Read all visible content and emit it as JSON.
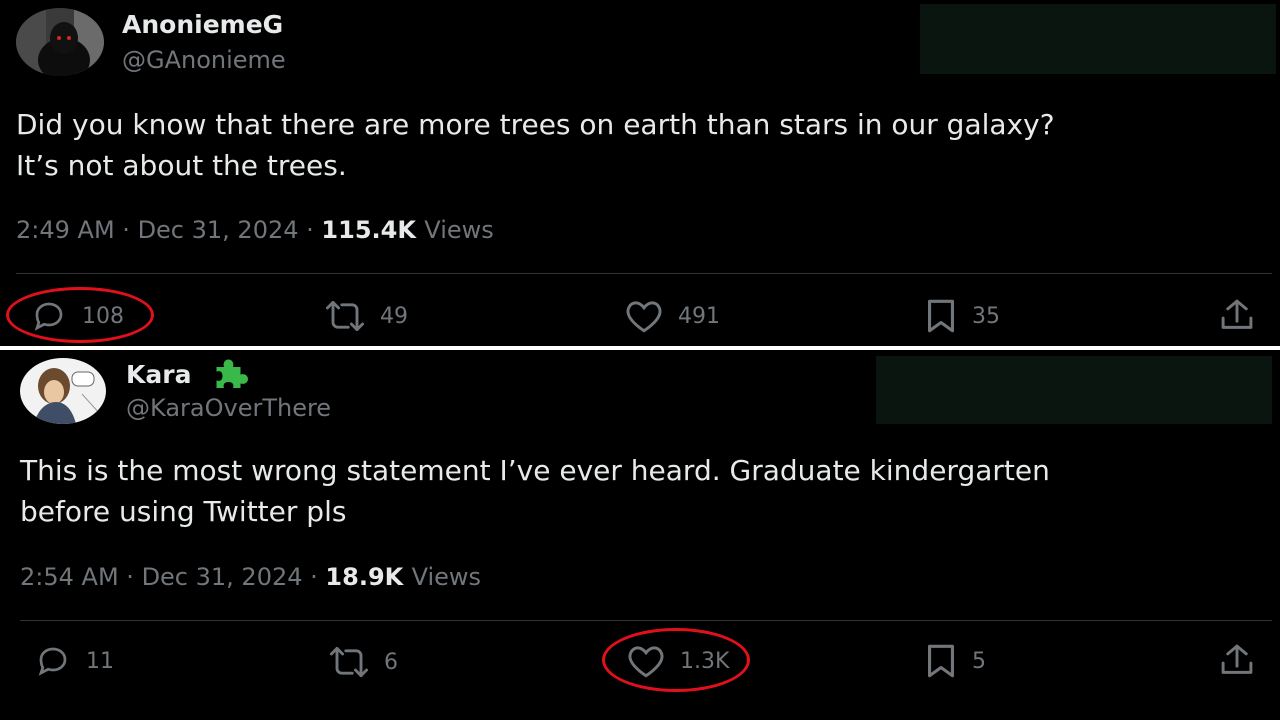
{
  "tweets": [
    {
      "display_name": "AnoniemeG",
      "handle": "@GAnonieme",
      "text_line1": "Did you know that there are more trees on earth than stars in our galaxy?",
      "text_line2": "It’s not about the trees.",
      "time": "2:49 AM",
      "date": "Dec 31, 2024",
      "views_count": "115.4K",
      "views_label": "Views",
      "replies": "108",
      "reposts": "49",
      "likes": "491",
      "bookmarks": "35",
      "highlighted": "replies"
    },
    {
      "display_name": "Kara",
      "badge_icon": "puzzle-piece-icon",
      "handle": "@KaraOverThere",
      "text_line1": "This is the most wrong statement I’ve ever heard. Graduate kindergarten",
      "text_line2": "before using Twitter pls",
      "time": "2:54 AM",
      "date": "Dec 31, 2024",
      "views_count": "18.9K",
      "views_label": "Views",
      "replies": "11",
      "reposts": "6",
      "likes": "1.3K",
      "bookmarks": "5",
      "highlighted": "likes"
    }
  ],
  "meta_separator": "·",
  "colors": {
    "background": "#000000",
    "text": "#e7e9ea",
    "secondary": "#71767b",
    "highlight_circle": "#e3101b",
    "badge": "#3bb84a"
  }
}
